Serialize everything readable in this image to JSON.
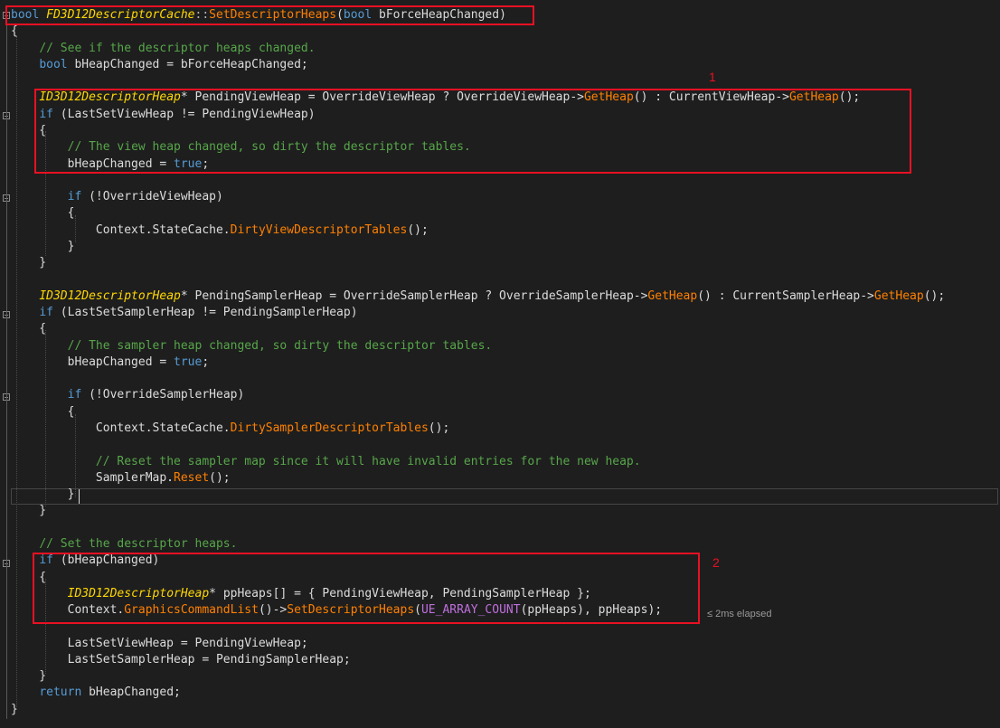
{
  "editor": {
    "lines": [
      [
        [
          "kw",
          "bool"
        ],
        [
          "pl",
          " "
        ],
        [
          "ty",
          "FD3D12DescriptorCache"
        ],
        [
          "op",
          "::"
        ],
        [
          "fn",
          "SetDescriptorHeaps"
        ],
        [
          "pl",
          "("
        ],
        [
          "kw",
          "bool"
        ],
        [
          "pl",
          " "
        ],
        [
          "vr",
          "bForceHeapChanged"
        ],
        [
          "pl",
          ")"
        ]
      ],
      [
        [
          "pl",
          "{"
        ]
      ],
      [
        [
          "pl",
          "    "
        ],
        [
          "cm",
          "// See if the descriptor heaps changed."
        ]
      ],
      [
        [
          "pl",
          "    "
        ],
        [
          "kw",
          "bool"
        ],
        [
          "pl",
          " bHeapChanged = bForceHeapChanged;"
        ]
      ],
      [],
      [
        [
          "pl",
          "    "
        ],
        [
          "ty",
          "ID3D12DescriptorHeap"
        ],
        [
          "pl",
          "* PendingViewHeap = OverrideViewHeap ? OverrideViewHeap->"
        ],
        [
          "fn",
          "GetHeap"
        ],
        [
          "pl",
          "() : CurrentViewHeap->"
        ],
        [
          "fn",
          "GetHeap"
        ],
        [
          "pl",
          "();"
        ]
      ],
      [
        [
          "pl",
          "    "
        ],
        [
          "kw",
          "if"
        ],
        [
          "pl",
          " (LastSetViewHeap != PendingViewHeap)"
        ]
      ],
      [
        [
          "pl",
          "    {"
        ]
      ],
      [
        [
          "pl",
          "        "
        ],
        [
          "cm",
          "// The view heap changed, so dirty the descriptor tables."
        ]
      ],
      [
        [
          "pl",
          "        bHeapChanged = "
        ],
        [
          "kw",
          "true"
        ],
        [
          "pl",
          ";"
        ]
      ],
      [],
      [
        [
          "pl",
          "        "
        ],
        [
          "kw",
          "if"
        ],
        [
          "pl",
          " (!OverrideViewHeap)"
        ]
      ],
      [
        [
          "pl",
          "        {"
        ]
      ],
      [
        [
          "pl",
          "            Context.StateCache."
        ],
        [
          "fn",
          "DirtyViewDescriptorTables"
        ],
        [
          "pl",
          "();"
        ]
      ],
      [
        [
          "pl",
          "        }"
        ]
      ],
      [
        [
          "pl",
          "    }"
        ]
      ],
      [],
      [
        [
          "pl",
          "    "
        ],
        [
          "ty",
          "ID3D12DescriptorHeap"
        ],
        [
          "pl",
          "* PendingSamplerHeap = OverrideSamplerHeap ? OverrideSamplerHeap->"
        ],
        [
          "fn",
          "GetHeap"
        ],
        [
          "pl",
          "() : CurrentSamplerHeap->"
        ],
        [
          "fn",
          "GetHeap"
        ],
        [
          "pl",
          "();"
        ]
      ],
      [
        [
          "pl",
          "    "
        ],
        [
          "kw",
          "if"
        ],
        [
          "pl",
          " (LastSetSamplerHeap != PendingSamplerHeap)"
        ]
      ],
      [
        [
          "pl",
          "    {"
        ]
      ],
      [
        [
          "pl",
          "        "
        ],
        [
          "cm",
          "// The sampler heap changed, so dirty the descriptor tables."
        ]
      ],
      [
        [
          "pl",
          "        bHeapChanged = "
        ],
        [
          "kw",
          "true"
        ],
        [
          "pl",
          ";"
        ]
      ],
      [],
      [
        [
          "pl",
          "        "
        ],
        [
          "kw",
          "if"
        ],
        [
          "pl",
          " (!OverrideSamplerHeap)"
        ]
      ],
      [
        [
          "pl",
          "        {"
        ]
      ],
      [
        [
          "pl",
          "            Context.StateCache."
        ],
        [
          "fn",
          "DirtySamplerDescriptorTables"
        ],
        [
          "pl",
          "();"
        ]
      ],
      [],
      [
        [
          "pl",
          "            "
        ],
        [
          "cm",
          "// Reset the sampler map since it will have invalid entries for the new heap."
        ]
      ],
      [
        [
          "pl",
          "            SamplerMap."
        ],
        [
          "fn",
          "Reset"
        ],
        [
          "pl",
          "();"
        ]
      ],
      [
        [
          "pl",
          "        }"
        ]
      ],
      [
        [
          "pl",
          "    }"
        ]
      ],
      [],
      [
        [
          "pl",
          "    "
        ],
        [
          "cm",
          "// Set the descriptor heaps."
        ]
      ],
      [
        [
          "pl",
          "    "
        ],
        [
          "kw",
          "if"
        ],
        [
          "pl",
          " (bHeapChanged)"
        ]
      ],
      [
        [
          "pl",
          "    {"
        ]
      ],
      [
        [
          "pl",
          "        "
        ],
        [
          "ty",
          "ID3D12DescriptorHeap"
        ],
        [
          "pl",
          "* ppHeaps[] = { PendingViewHeap, PendingSamplerHeap };"
        ]
      ],
      [
        [
          "pl",
          "        Context."
        ],
        [
          "fn",
          "GraphicsCommandList"
        ],
        [
          "pl",
          "()->"
        ],
        [
          "fn",
          "SetDescriptorHeaps"
        ],
        [
          "pl",
          "("
        ],
        [
          "mac",
          "UE_ARRAY_COUNT"
        ],
        [
          "pl",
          "(ppHeaps), ppHeaps);"
        ]
      ],
      [],
      [
        [
          "pl",
          "        LastSetViewHeap = PendingViewHeap;"
        ]
      ],
      [
        [
          "pl",
          "        LastSetSamplerHeap = PendingSamplerHeap;"
        ]
      ],
      [
        [
          "pl",
          "    }"
        ]
      ],
      [
        [
          "pl",
          "    "
        ],
        [
          "kw",
          "return"
        ],
        [
          "pl",
          " bHeapChanged;"
        ]
      ],
      [
        [
          "pl",
          "}"
        ]
      ]
    ]
  },
  "annotations": {
    "label_1": "1",
    "label_2": "2"
  },
  "perf_hint": "≤ 2ms elapsed",
  "colors": {
    "background": "#1e1e1e",
    "keyword": "#569cd6",
    "type": "#ffd700",
    "function": "#ff8000",
    "macro": "#be6fdc",
    "comment": "#57a64a",
    "plain": "#dcdcdc",
    "annotation": "#e81123"
  }
}
